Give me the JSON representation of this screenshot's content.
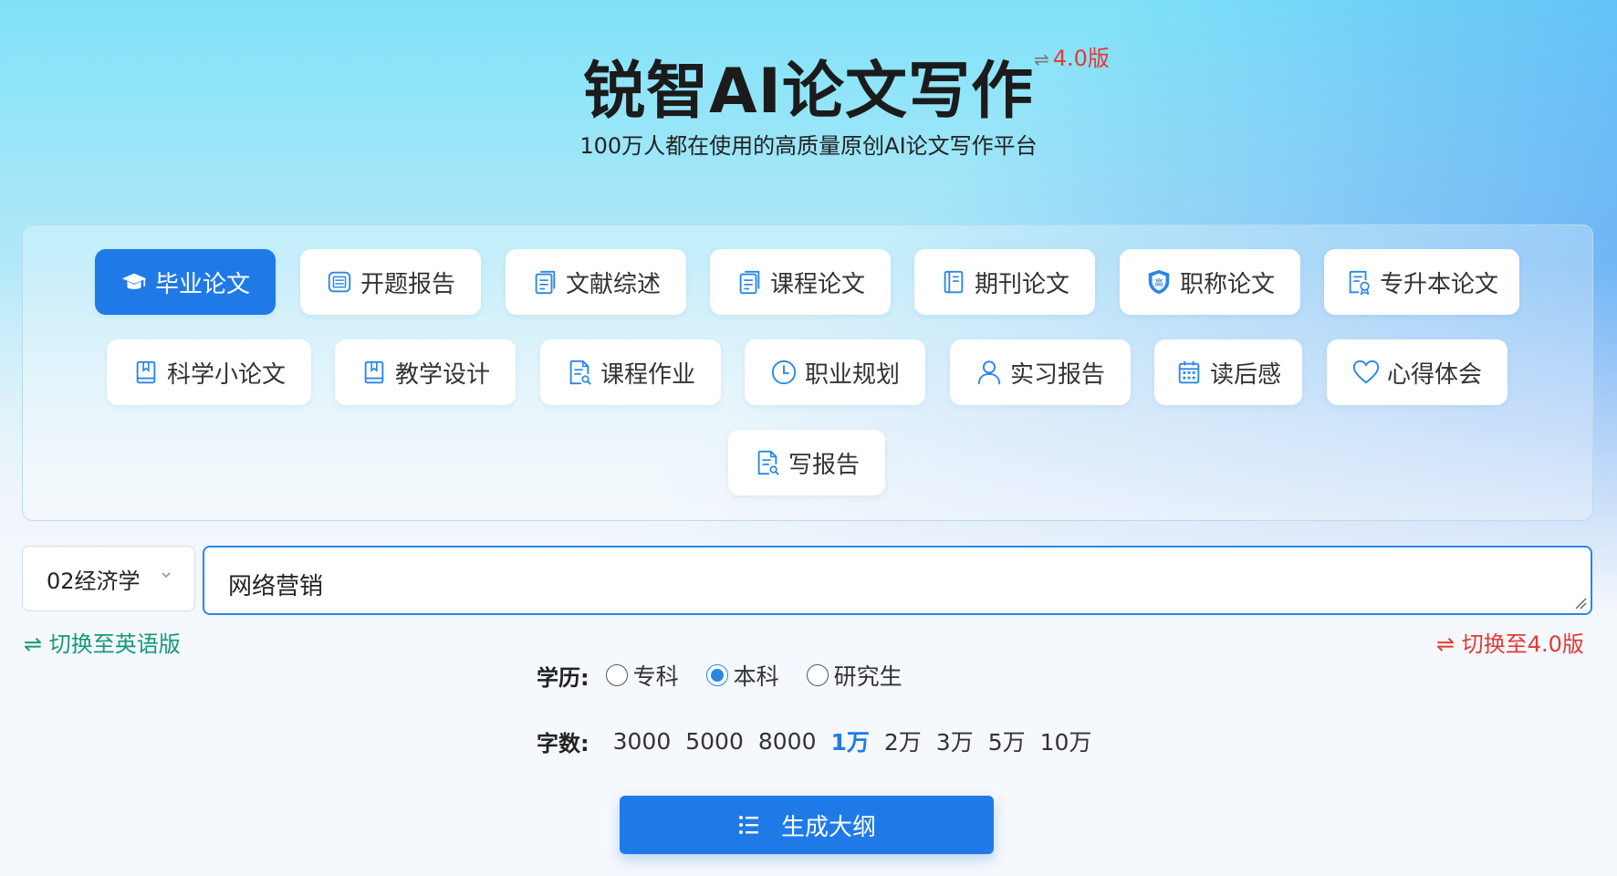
{
  "header": {
    "title": "锐智AI论文写作",
    "version_badge": "4.0版",
    "version_switch_icon": "⇌",
    "subtitle": "100万人都在使用的高质量原创AI论文写作平台"
  },
  "types": [
    {
      "label": "毕业论文",
      "icon": "graduation-cap-icon",
      "active": true
    },
    {
      "label": "开题报告",
      "icon": "list-window-icon",
      "active": false
    },
    {
      "label": "文献综述",
      "icon": "clipboard-icon",
      "active": false
    },
    {
      "label": "课程论文",
      "icon": "clipboard-icon",
      "active": false
    },
    {
      "label": "期刊论文",
      "icon": "journal-icon",
      "active": false
    },
    {
      "label": "职称论文",
      "icon": "shield-badge-icon",
      "active": false
    },
    {
      "label": "专升本论文",
      "icon": "certificate-doc-icon",
      "active": false
    },
    {
      "label": "科学小论文",
      "icon": "bookmark-book-icon",
      "active": false
    },
    {
      "label": "教学设计",
      "icon": "bookmark-book-icon",
      "active": false
    },
    {
      "label": "课程作业",
      "icon": "document-search-icon",
      "active": false
    },
    {
      "label": "职业规划",
      "icon": "clock-icon",
      "active": false
    },
    {
      "label": "实习报告",
      "icon": "user-icon",
      "active": false
    },
    {
      "label": "读后感",
      "icon": "calendar-icon",
      "active": false
    },
    {
      "label": "心得体会",
      "icon": "heart-icon",
      "active": false
    },
    {
      "label": "写报告",
      "icon": "document-search-icon",
      "active": false
    }
  ],
  "form": {
    "discipline": "02经济学",
    "topic": "网络营销",
    "switch_english": "⇌ 切换至英语版",
    "switch_v4": "⇌ 切换至4.0版"
  },
  "education": {
    "label": "学历:",
    "options": [
      {
        "label": "专科",
        "checked": false
      },
      {
        "label": "本科",
        "checked": true
      },
      {
        "label": "研究生",
        "checked": false
      }
    ]
  },
  "word_count": {
    "label": "字数:",
    "options": [
      "3000",
      "5000",
      "8000",
      "1万",
      "2万",
      "3万",
      "5万",
      "10万"
    ],
    "selected": "1万"
  },
  "generate_button": {
    "label": "生成大纲",
    "icon": "list-icon"
  },
  "colors": {
    "accent": "#1f7ae8",
    "red": "#e53935",
    "green": "#14997a"
  }
}
